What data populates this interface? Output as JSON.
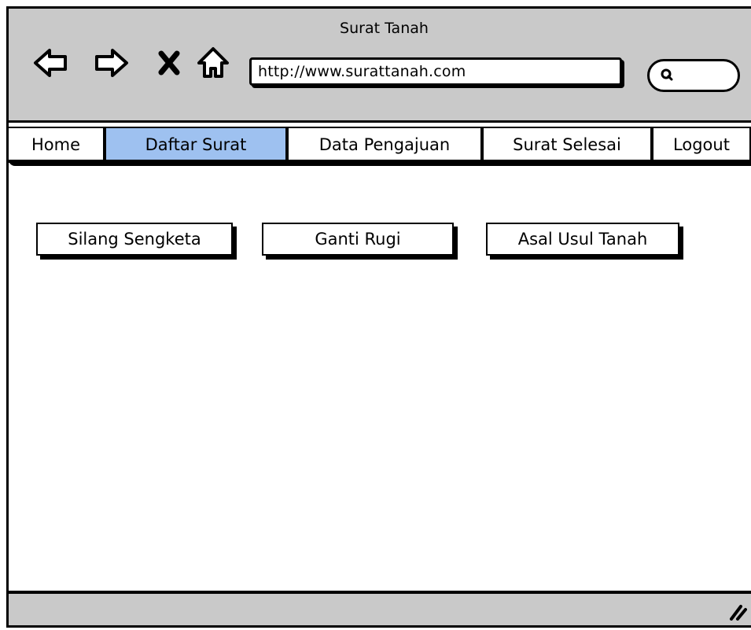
{
  "window": {
    "title": "Surat Tanah"
  },
  "toolbar": {
    "back_icon": "left-arrow-outline",
    "forward_icon": "right-arrow-outline",
    "stop_icon": "x-mark",
    "home_icon": "house-outline",
    "url": "http://www.surattanah.com",
    "search_icon": "magnifier"
  },
  "tabs": [
    {
      "label": "Home",
      "active": false
    },
    {
      "label": "Daftar Surat",
      "active": true
    },
    {
      "label": "Data Pengajuan",
      "active": false
    },
    {
      "label": "Surat Selesai",
      "active": false
    },
    {
      "label": "Logout",
      "active": false
    }
  ],
  "content": {
    "buttons": [
      {
        "label": "Silang Sengketa"
      },
      {
        "label": "Ganti Rugi"
      },
      {
        "label": "Asal Usul Tanah"
      }
    ]
  },
  "colors": {
    "chrome": "#c9c9c9",
    "active_tab": "#9ec1f0",
    "background": "#ffffff"
  }
}
